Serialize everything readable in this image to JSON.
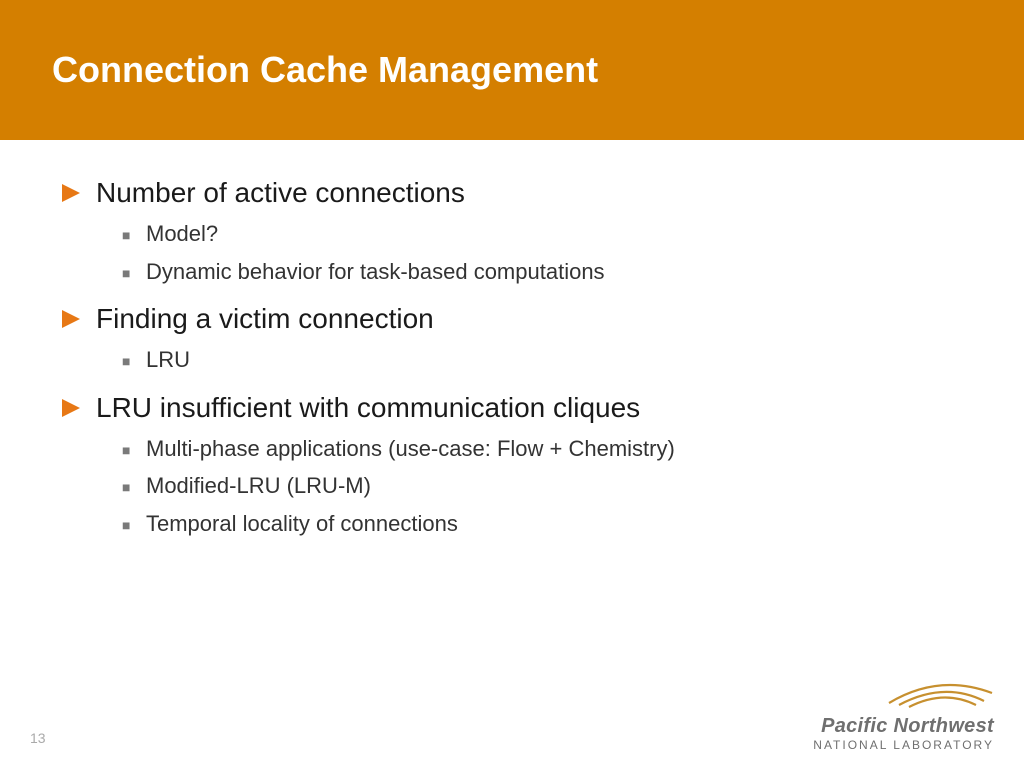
{
  "colors": {
    "accent": "#d47f00",
    "bullet1": "#e77815",
    "bullet2": "#7a7a7a"
  },
  "title": "Connection Cache Management",
  "bullets": [
    {
      "text": "Number of active connections",
      "sub": [
        "Model?",
        "Dynamic behavior for task-based computations"
      ]
    },
    {
      "text": "Finding a victim connection",
      "sub": [
        "LRU"
      ]
    },
    {
      "text": "LRU insufficient with communication cliques",
      "sub": [
        "Multi-phase applications (use-case: Flow + Chemistry)",
        "Modified-LRU (LRU-M)",
        "Temporal locality of connections"
      ]
    }
  ],
  "page_number": "13",
  "logo": {
    "line1": "Pacific Northwest",
    "line2": "NATIONAL LABORATORY"
  }
}
